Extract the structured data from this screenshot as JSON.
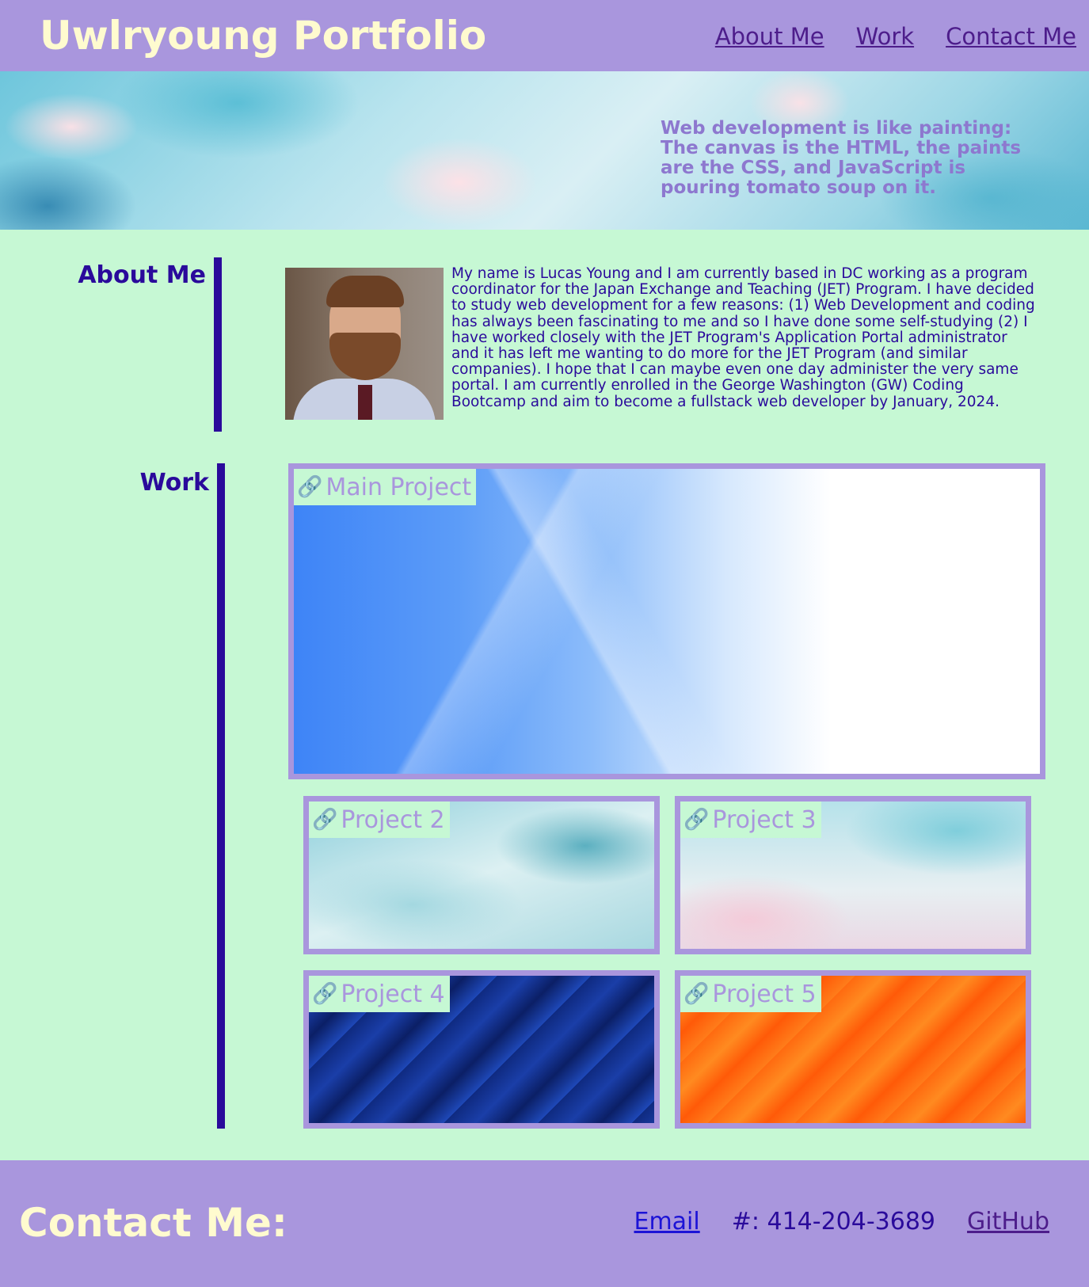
{
  "header": {
    "title": "Uwlryoung Portfolio",
    "nav": [
      "About Me",
      "Work",
      "Contact Me"
    ]
  },
  "hero": {
    "quote": "Web development is like painting: The canvas is the HTML, the paints are the CSS, and JavaScript is pouring tomato soup on it."
  },
  "about": {
    "heading": "About Me",
    "text": "My name is Lucas Young and I am currently based in DC working as a program coordinator for the Japan Exchange and Teaching (JET) Program. I have decided to study web development for a few reasons: (1) Web Development and coding has always been fascinating to me and so I have done some self-studying (2) I have worked closely with the JET Program's Application Portal administrator and it has left me wanting to do more for the JET Program (and similar companies). I hope that I can maybe even one day administer the very same portal. I am currently enrolled in the George Washington (GW) Coding Bootcamp and aim to become a fullstack web developer by January, 2024."
  },
  "work": {
    "heading": "Work",
    "projects": [
      "Main Project",
      "Project 2",
      "Project 3",
      "Project 4",
      "Project 5"
    ],
    "link_icon": "link-icon"
  },
  "footer": {
    "title": "Contact Me:",
    "email": "Email",
    "phone": "#: 414-204-3689",
    "github": "GitHub"
  },
  "colors": {
    "header_bg": "#a996dd",
    "page_bg": "#c6f8d4",
    "title_text": "#fffbcf",
    "accent": "#2a0a9b"
  }
}
